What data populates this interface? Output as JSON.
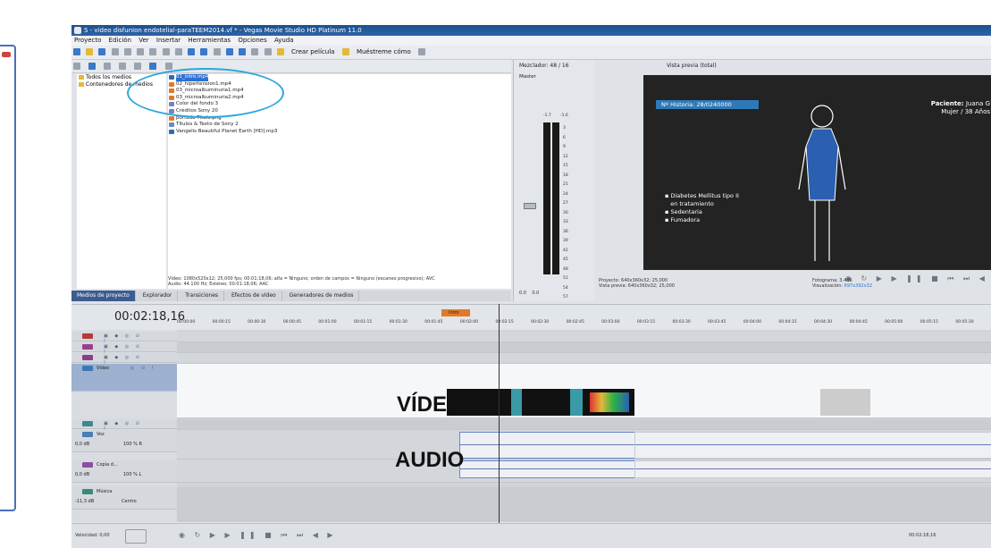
{
  "window": {
    "title": "S - video disfunion endotelial-paraTEEM2014.vf * - Vegas Movie Studio HD Platinum 11.0"
  },
  "menu": [
    "Proyecto",
    "Edición",
    "Ver",
    "Insertar",
    "Herramientas",
    "Opciones",
    "Ayuda"
  ],
  "toolbar": {
    "create_movie": "Crear película",
    "show_me": "Muéstreme cómo"
  },
  "media": {
    "tree": [
      "Todos los medios",
      "Contenedores de medios"
    ],
    "files": [
      "01_intro.mp4",
      "02_hipertension1.mp4",
      "03_microalbuminuria1.mp4",
      "03_microalbuminuria2.mp4",
      "Color del fondo 3",
      "Créditos Sony 20",
      "portada Título.png",
      "Títulos & Texto de Sony 2",
      "Vangelis  Beautiful Planet Earth [HD].mp3"
    ],
    "info_line1": "Vídeo: 1080x520x12; 25,000 fps; 00:01:18,06; alfa = Ninguno; orden de campos = Ninguno (escaneo progresivo); AVC",
    "info_line2": "Audio: 44.100 Hz; Estéreo; 00:01:18,06; AAC"
  },
  "tabs": [
    "Medios de proyecto",
    "Explorador",
    "Transiciones",
    "Efectos de vídeo",
    "Generadores de medios"
  ],
  "mixer": {
    "title": "Mezclador: 48 / 16",
    "master": "Master",
    "peaks": [
      "-1.7",
      "-1.6"
    ],
    "scale": [
      "3",
      "6",
      "9",
      "12",
      "15",
      "18",
      "21",
      "24",
      "27",
      "30",
      "33",
      "36",
      "39",
      "42",
      "45",
      "48",
      "51",
      "54",
      "57"
    ],
    "footer": [
      "0.0",
      "0.0"
    ]
  },
  "preview": {
    "header": "Vista previa (total)",
    "historia": "Nº Historia: 28/0240000",
    "paciente_label": "Paciente:",
    "paciente_name": "Juana G",
    "paciente_detail": "Mujer / 38 Años",
    "bullets": [
      "Diabetes Mellitus tipo II",
      "en tratamiento",
      "Sedentaria",
      "Fumadora"
    ],
    "project_info": "Proyecto:   640x360x32; 25,000",
    "preview_info": "Vista previa: 640x360x32; 25,000",
    "frame_label": "Fotograma:",
    "frame_value": "3.466",
    "display_label": "Visualización:",
    "display_value": "697x392x32"
  },
  "timeline": {
    "timecode": "00:02:18,16",
    "marker": "Intro",
    "ruler": [
      "00:00:00",
      "00:00:15",
      "00:00:30",
      "00:00:45",
      "00:01:00",
      "00:01:15",
      "00:01:30",
      "00:01:45",
      "00:02:00",
      "00:02:15",
      "00:02:30",
      "00:02:45",
      "00:03:00",
      "00:03:15",
      "00:03:30",
      "00:03:45",
      "00:04:00",
      "00:04:15",
      "00:04:30",
      "00:04:45",
      "00:05:00",
      "00:05:15",
      "00:05:30"
    ],
    "video_track": "Vídeo",
    "voice_track": "Voz",
    "copy_track": "Copia d...",
    "music_track": "Música",
    "voice_db": "0,0 dB",
    "voice_pan": "100 % R",
    "copy_db": "0,0 dB",
    "copy_pan": "100 % L",
    "music_db": "-11,3 dB",
    "music_pan": "Centro",
    "label_video": "VÍDEO",
    "label_audio": "AUDIO"
  },
  "status": {
    "speed": "Velocidad: 0,00",
    "time": "00:02:18,16"
  }
}
